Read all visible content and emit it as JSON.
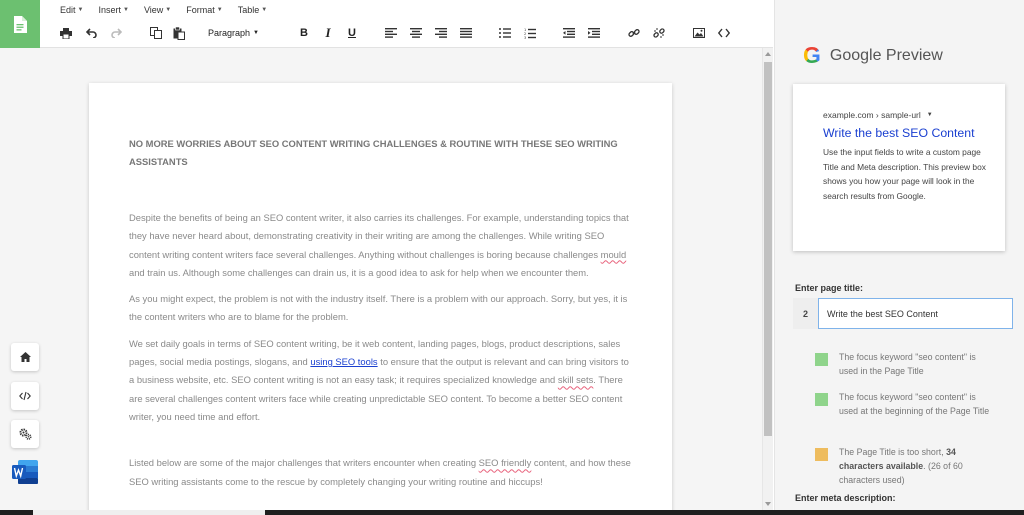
{
  "menubar": {
    "edit": "Edit",
    "insert": "Insert",
    "view": "View",
    "format": "Format",
    "table": "Table"
  },
  "toolbar": {
    "paragraph": "Paragraph",
    "bold": "B",
    "italic": "I",
    "underline": "U"
  },
  "document": {
    "heading": "NO MORE WORRIES ABOUT SEO CONTENT WRITING CHALLENGES & ROUTINE WITH THESE SEO WRITING ASSISTANTS",
    "p1_a": "Despite the benefits of being an SEO content writer, it also carries its challenges. For example, understanding topics that they have never heard about, demonstrating creativity in their writing are among the challenges. While writing SEO content writing content writers face several challenges. Anything without challenges is boring because challenges ",
    "p1_spell": "mould",
    "p1_b": " and train us. Although some challenges can drain us, it is a good idea to ask for help when we encounter them.",
    "p2": "As you might expect, the problem is not with the industry itself. There is a problem with our approach. Sorry, but yes, it is the content writers who are to blame for the problem.",
    "p3_a": "We set daily goals in terms of SEO content writing, be it web content, landing pages, blogs, product descriptions, sales pages, social media postings, slogans, and ",
    "p3_link": "using SEO tools",
    "p3_b": " to ensure that the output is relevant and can bring visitors to a business website, etc. SEO content writing is not an easy task; it requires specialized knowledge and ",
    "p3_spell": "skill sets",
    "p3_c": ". There are several challenges content writers face while creating unpredictable SEO content. To become a better SEO content writer, you need time and effort.",
    "p4_a": "Listed below are some of the major challenges that writers encounter when creating ",
    "p4_spell": "SEO friendly",
    "p4_b": " content, and how these SEO writing assistants come to the rescue by completely changing your writing routine and hiccups!"
  },
  "preview": {
    "google_letter": "G",
    "title": "Google Preview",
    "url": "example.com › sample-url",
    "serp_title": "Write the best SEO Content",
    "serp_desc": "Use the input fields to write a custom page Title and Meta description. This preview box shows you how your page will look in the search results from Google."
  },
  "page_title_field": {
    "label": "Enter page title:",
    "step": "2",
    "value": "Write the best SEO Content"
  },
  "checks": [
    {
      "color": "#8fd48b",
      "text": "The focus keyword \"seo content\" is used in the Page Title"
    },
    {
      "color": "#8fd48b",
      "text": "The focus keyword \"seo content\" is used at the beginning of the Page Title"
    },
    {
      "color": "#eebc5e",
      "text_a": "The Page Title is too short, ",
      "text_bold": "34 characters available",
      "text_b": ". (26 of 60 characters used)"
    }
  ],
  "meta_field": {
    "label": "Enter meta description:"
  }
}
